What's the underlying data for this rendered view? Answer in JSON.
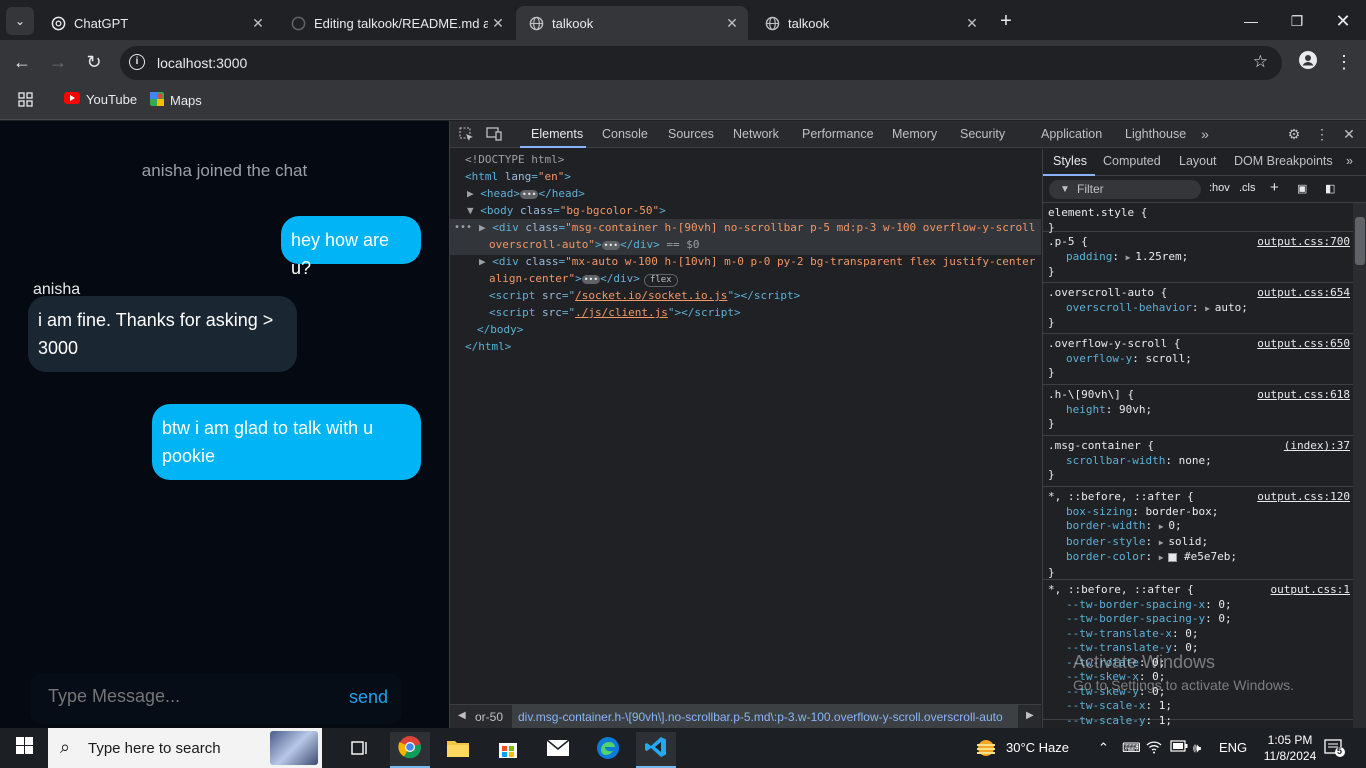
{
  "browser": {
    "tabs": [
      {
        "title": "ChatGPT",
        "icon": "chatgpt-icon"
      },
      {
        "title": "Editing talkook/README.md at",
        "icon": "github-icon"
      },
      {
        "title": "talkook",
        "icon": "globe-icon",
        "active": true
      },
      {
        "title": "talkook",
        "icon": "globe-icon"
      }
    ],
    "url": "localhost:3000",
    "bookmarks": [
      {
        "label": "YouTube",
        "icon": "youtube-icon"
      },
      {
        "label": "Maps",
        "icon": "maps-icon"
      }
    ]
  },
  "chat": {
    "system_message": "anisha joined the chat",
    "messages": [
      {
        "direction": "out",
        "text": "hey how are u?"
      },
      {
        "direction": "in",
        "sender": "anisha",
        "text_line1": "i am fine. Thanks for asking >",
        "text_line2": "3000"
      },
      {
        "direction": "out",
        "text_line1": "btw i am glad to talk with u",
        "text_line2": "pookie"
      }
    ],
    "sender_name": "anisha",
    "input_placeholder": "Type Message...",
    "send_label": "send"
  },
  "devtools": {
    "tabs": [
      "Elements",
      "Console",
      "Sources",
      "Network",
      "Performance",
      "Memory",
      "Security",
      "Application",
      "Lighthouse"
    ],
    "active_tab": "Elements",
    "dom": {
      "doctype": "<!DOCTYPE html>",
      "html_open_tag": "<html",
      "html_attr": "lang",
      "html_val": "\"en\"",
      "head": "<head>",
      "head_close": "</head>",
      "body_tag": "<body",
      "body_attr": "class",
      "body_val": "\"bg-bgcolor-50\"",
      "div1_tag": "<div",
      "div1_attr": "class",
      "div1_val_line1": "\"msg-container  h-[90vh] no-scrollbar p-5 md:p-3 w-100 overflow-y-scroll",
      "div1_val_line2": "overscroll-auto\"",
      "div1_suffix": "== $0",
      "div2_tag": "<div",
      "div2_attr": "class",
      "div2_val_line1": "\"mx-auto w-100 h-[10vh] m-0 p-0 py-2 bg-transparent flex justify-center",
      "div2_val_line2": "align-center\"",
      "div2_badge": "flex",
      "script1_src": "/socket.io/socket.io.js",
      "script2_src": "./js/client.js",
      "body_close": "</body>",
      "html_close": "</html>"
    },
    "breadcrumb": {
      "left": "or-50",
      "current": "div.msg-container.h-\\[90vh\\].no-scrollbar.p-5.md\\:p-3.w-100.overflow-y-scroll.overscroll-auto"
    },
    "styles_tabs": [
      "Styles",
      "Computed",
      "Layout",
      "DOM Breakpoints"
    ],
    "filter_placeholder": "Filter",
    "filter_buttons": [
      ":hov",
      ".cls"
    ],
    "rules": [
      {
        "selector": "element.style {",
        "props": [],
        "source": ""
      },
      {
        "selector": ".p-5 {",
        "props": [
          {
            "name": "padding",
            "value": "1.25rem;",
            "arrow": true
          }
        ],
        "source": "output.css:700"
      },
      {
        "selector": ".overscroll-auto {",
        "props": [
          {
            "name": "overscroll-behavior",
            "value": "auto;",
            "arrow": true
          }
        ],
        "source": "output.css:654"
      },
      {
        "selector": ".overflow-y-scroll {",
        "props": [
          {
            "name": "overflow-y",
            "value": "scroll;"
          }
        ],
        "source": "output.css:650"
      },
      {
        "selector": ".h-\\[90vh\\] {",
        "props": [
          {
            "name": "height",
            "value": "90vh;"
          }
        ],
        "source": "output.css:618"
      },
      {
        "selector": ".msg-container {",
        "props": [
          {
            "name": "scrollbar-width",
            "value": "none;"
          }
        ],
        "source": "(index):37"
      },
      {
        "selector": "*, ::before, ::after {",
        "props": [
          {
            "name": "box-sizing",
            "value": "border-box;"
          },
          {
            "name": "border-width",
            "value": "0;",
            "arrow": true
          },
          {
            "name": "border-style",
            "value": "solid;",
            "arrow": true
          },
          {
            "name": "border-color",
            "value": "#e5e7eb;",
            "arrow": true,
            "swatch": true
          }
        ],
        "source": "output.css:120"
      },
      {
        "selector": "*, ::before, ::after {",
        "props": [
          {
            "name": "--tw-border-spacing-x",
            "value": "0;"
          },
          {
            "name": "--tw-border-spacing-y",
            "value": "0;"
          },
          {
            "name": "--tw-translate-x",
            "value": "0;"
          },
          {
            "name": "--tw-translate-y",
            "value": "0;"
          },
          {
            "name": "--tw-rotate",
            "value": "0;"
          },
          {
            "name": "--tw-skew-x",
            "value": "0;"
          },
          {
            "name": "--tw-skew-y",
            "value": "0;"
          },
          {
            "name": "--tw-scale-x",
            "value": "1;"
          },
          {
            "name": "--tw-scale-y",
            "value": "1;"
          }
        ],
        "source": "output.css:1"
      }
    ]
  },
  "watermark": {
    "line1": "Activate Windows",
    "line2": "Go to Settings to activate Windows."
  },
  "taskbar": {
    "search_placeholder": "Type here to search",
    "weather": "30°C  Haze",
    "language": "ENG",
    "time": "1:05 PM",
    "date": "11/8/2024",
    "notifications": "5"
  }
}
